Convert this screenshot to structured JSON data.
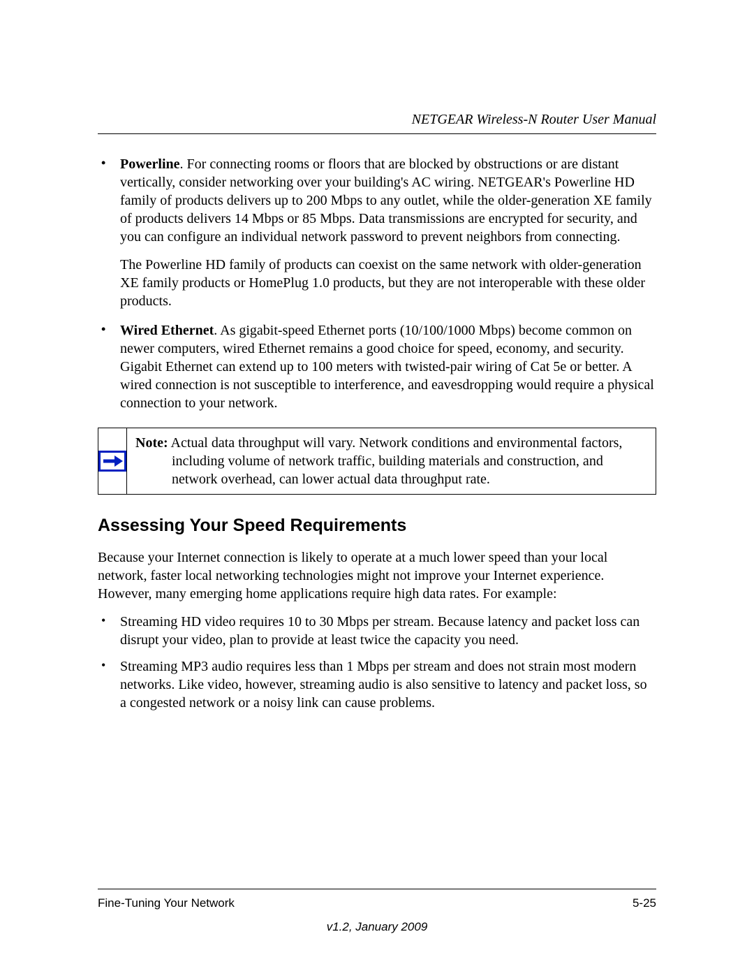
{
  "header": {
    "title": "NETGEAR Wireless-N Router User Manual"
  },
  "bullets": [
    {
      "lead": "Powerline",
      "paras": [
        ". For connecting rooms or floors that are blocked by obstructions or are distant vertically, consider networking over your building's AC wiring. NETGEAR's Powerline HD family of products delivers up to 200 Mbps to any outlet, while the older-generation XE family of products delivers 14 Mbps or 85 Mbps. Data transmissions are encrypted for security, and you can configure an individual network password to prevent neighbors from connecting.",
        "The Powerline HD family of products can coexist on the same network with older-generation XE family products or HomePlug 1.0 products, but they are not interoperable with these older products."
      ]
    },
    {
      "lead": "Wired Ethernet",
      "paras": [
        ". As gigabit-speed Ethernet ports (10/100/1000 Mbps) become common on newer computers, wired Ethernet remains a good choice for speed, economy, and security. Gigabit Ethernet can extend up to 100 meters with twisted-pair wiring of Cat 5e or better. A wired connection is not susceptible to interference, and eavesdropping would require a physical connection to your network."
      ]
    }
  ],
  "note": {
    "label": "Note:",
    "line1": " Actual data throughput will vary. Network conditions and environmental factors,",
    "rest": "including volume of network traffic, building materials and construction, and network overhead, can lower actual data throughput rate."
  },
  "section": {
    "heading": "Assessing Your Speed Requirements",
    "intro": "Because your Internet connection is likely to operate at a much lower speed than your local network, faster local networking technologies might not improve your Internet experience. However, many emerging home applications require high data rates. For example:",
    "items": [
      "Streaming HD video requires 10 to 30 Mbps per stream. Because latency and packet loss can disrupt your video, plan to provide at least twice the capacity you need.",
      "Streaming MP3 audio requires less than 1 Mbps per stream and does not strain most modern networks. Like video, however, streaming audio is also sensitive to latency and packet loss, so a congested network or a noisy link can cause problems."
    ]
  },
  "footer": {
    "left": "Fine-Tuning Your Network",
    "right": "5-25",
    "version": "v1.2, January 2009"
  }
}
